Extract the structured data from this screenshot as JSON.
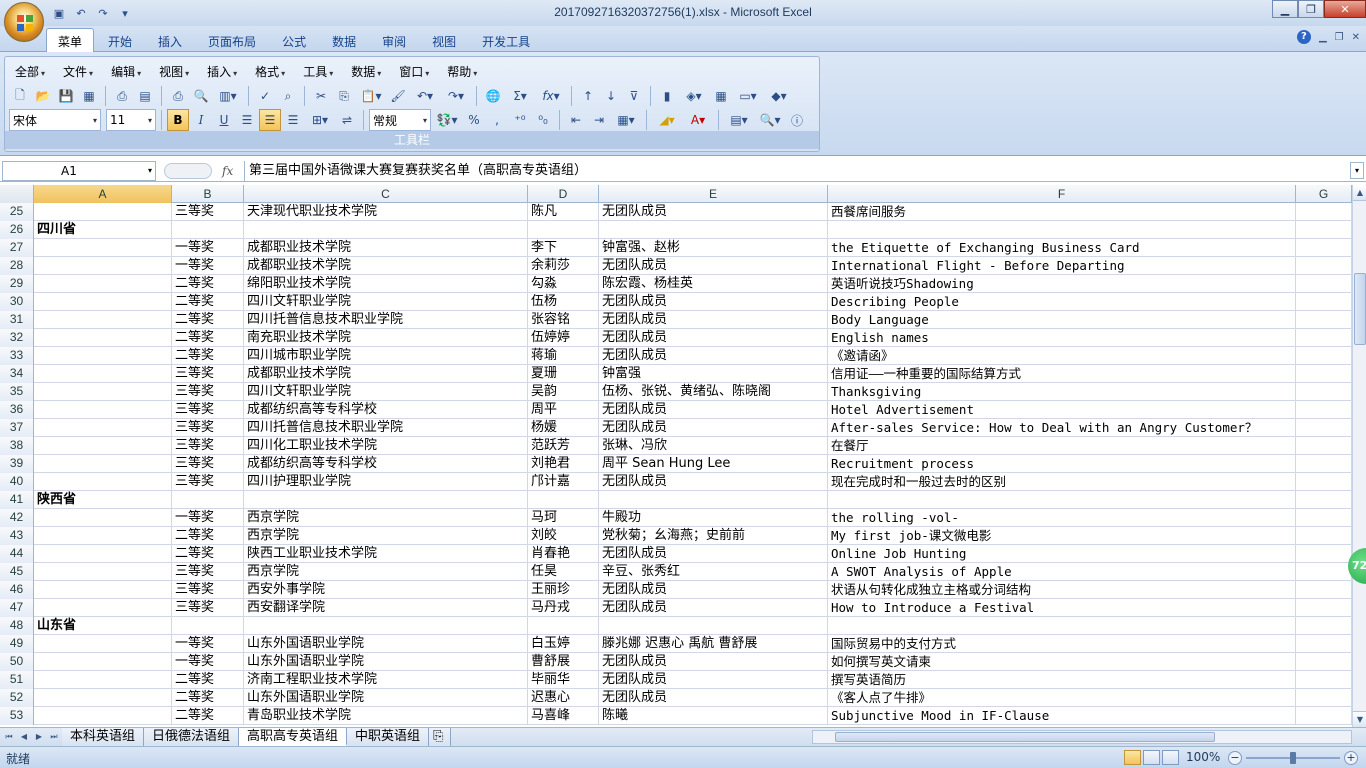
{
  "window": {
    "title": "2017092716320372756(1).xlsx - Microsoft Excel"
  },
  "ribbon_tabs": [
    "菜单",
    "开始",
    "插入",
    "页面布局",
    "公式",
    "数据",
    "审阅",
    "视图",
    "开发工具"
  ],
  "active_tab_index": 0,
  "menu_items": [
    "全部",
    "文件",
    "编辑",
    "视图",
    "插入",
    "格式",
    "工具",
    "数据",
    "窗口",
    "帮助"
  ],
  "toolbar": {
    "font_name": "宋体",
    "font_size": "11",
    "number_format": "常规",
    "bold_label": "B",
    "italic_label": "I",
    "underline_label": "U",
    "sigma_label": "Σ",
    "fx_label": "fx",
    "percent_label": "%",
    "comma_label": ",",
    "group_label": "工具栏"
  },
  "formula_bar": {
    "name_box": "A1",
    "fx_label": "fx",
    "content": "第三届中国外语微课大赛复赛获奖名单（高职高专英语组）"
  },
  "columns": [
    "A",
    "B",
    "C",
    "D",
    "E",
    "F",
    "G"
  ],
  "rows": [
    {
      "n": "25",
      "a": "",
      "b": "三等奖",
      "c": "天津现代职业技术学院",
      "d": "陈凡",
      "e": "无团队成员",
      "f": "西餐席间服务"
    },
    {
      "n": "26",
      "a": "四川省",
      "b": "",
      "c": "",
      "d": "",
      "e": "",
      "f": ""
    },
    {
      "n": "27",
      "a": "",
      "b": "一等奖",
      "c": "成都职业技术学院",
      "d": "李下",
      "e": "钟富强、赵彬",
      "f": "the Etiquette of Exchanging Business Card"
    },
    {
      "n": "28",
      "a": "",
      "b": "一等奖",
      "c": "成都职业技术学院",
      "d": "余莉莎",
      "e": "无团队成员",
      "f": "International Flight - Before Departing"
    },
    {
      "n": "29",
      "a": "",
      "b": "二等奖",
      "c": "绵阳职业技术学院",
      "d": "勾淼",
      "e": "陈宏霞、杨桂英",
      "f": " 英语听说技巧Shadowing"
    },
    {
      "n": "30",
      "a": "",
      "b": "二等奖",
      "c": "四川文轩职业学院",
      "d": "伍杨",
      "e": "无团队成员",
      "f": "Describing People"
    },
    {
      "n": "31",
      "a": "",
      "b": "二等奖",
      "c": "四川托普信息技术职业学院",
      "d": "张容铭",
      "e": "无团队成员",
      "f": "Body Language"
    },
    {
      "n": "32",
      "a": "",
      "b": "二等奖",
      "c": "南充职业技术学院",
      "d": "伍婷婷",
      "e": "无团队成员",
      "f": "English names"
    },
    {
      "n": "33",
      "a": "",
      "b": "二等奖",
      "c": "四川城市职业学院",
      "d": "蒋瑜",
      "e": "无团队成员",
      "f": "《邀请函》"
    },
    {
      "n": "34",
      "a": "",
      "b": "三等奖",
      "c": "成都职业技术学院",
      "d": "夏珊",
      "e": "钟富强",
      "f": "信用证——一种重要的国际结算方式"
    },
    {
      "n": "35",
      "a": "",
      "b": "三等奖",
      "c": "四川文轩职业学院",
      "d": "吴韵",
      "e": "伍杨、张锐、黄绪弘、陈晓阁",
      "f": "Thanksgiving"
    },
    {
      "n": "36",
      "a": "",
      "b": "三等奖",
      "c": "成都纺织高等专科学校",
      "d": "周平",
      "e": "无团队成员",
      "f": "Hotel Advertisement"
    },
    {
      "n": "37",
      "a": "",
      "b": "三等奖",
      "c": "四川托普信息技术职业学院",
      "d": "杨媛",
      "e": "无团队成员",
      "f": "After-sales Service:  How to Deal with an Angry Customer？"
    },
    {
      "n": "38",
      "a": "",
      "b": "三等奖",
      "c": "四川化工职业技术学院",
      "d": "范跃芳",
      "e": "张琳、冯欣",
      "f": "在餐厅"
    },
    {
      "n": "39",
      "a": "",
      "b": "三等奖",
      "c": "成都纺织高等专科学校",
      "d": "刘艳君",
      "e": "周平 Sean Hung Lee",
      "f": "Recruitment process"
    },
    {
      "n": "40",
      "a": "",
      "b": "三等奖",
      "c": "四川护理职业学院",
      "d": "邝计嘉",
      "e": "无团队成员",
      "f": "现在完成时和一般过去时的区别"
    },
    {
      "n": "41",
      "a": "陕西省",
      "b": "",
      "c": "",
      "d": "",
      "e": "",
      "f": ""
    },
    {
      "n": "42",
      "a": "",
      "b": "一等奖",
      "c": "西京学院",
      "d": "马珂",
      "e": "牛殿功",
      "f": "the rolling -vol-"
    },
    {
      "n": "43",
      "a": "",
      "b": "二等奖",
      "c": "西京学院",
      "d": "刘皎",
      "e": "党秋菊；幺海燕；史前前",
      "f": "My first job-课文微电影"
    },
    {
      "n": "44",
      "a": "",
      "b": "二等奖",
      "c": "陕西工业职业技术学院",
      "d": "肖春艳",
      "e": "无团队成员",
      "f": "Online Job Hunting"
    },
    {
      "n": "45",
      "a": "",
      "b": "三等奖",
      "c": "西京学院",
      "d": "任昊",
      "e": "辛豆、张秀红",
      "f": "A SWOT Analysis of Apple"
    },
    {
      "n": "46",
      "a": "",
      "b": "三等奖",
      "c": "西安外事学院",
      "d": "王丽珍",
      "e": "无团队成员",
      "f": "状语从句转化成独立主格或分词结构"
    },
    {
      "n": "47",
      "a": "",
      "b": "三等奖",
      "c": "西安翻译学院",
      "d": "马丹戎",
      "e": "无团队成员",
      "f": "How to Introduce a Festival"
    },
    {
      "n": "48",
      "a": "山东省",
      "b": "",
      "c": "",
      "d": "",
      "e": "",
      "f": ""
    },
    {
      "n": "49",
      "a": "",
      "b": "一等奖",
      "c": "山东外国语职业学院",
      "d": "白玉婷",
      "e": "滕兆娜 迟惠心 禹航 曹舒展",
      "f": "国际贸易中的支付方式"
    },
    {
      "n": "50",
      "a": "",
      "b": "一等奖",
      "c": "山东外国语职业学院",
      "d": "曹舒展",
      "e": "无团队成员",
      "f": "如何撰写英文请柬"
    },
    {
      "n": "51",
      "a": "",
      "b": "二等奖",
      "c": "济南工程职业技术学院",
      "d": "毕丽华",
      "e": "无团队成员",
      "f": "撰写英语简历"
    },
    {
      "n": "52",
      "a": "",
      "b": "二等奖",
      "c": "山东外国语职业学院",
      "d": "迟惠心",
      "e": "无团队成员",
      "f": "《客人点了牛排》"
    },
    {
      "n": "53",
      "a": "",
      "b": "二等奖",
      "c": "青岛职业技术学院",
      "d": "马喜峰",
      "e": "陈曦",
      "f": "Subjunctive Mood in IF-Clause"
    }
  ],
  "sheet_tabs": [
    "本科英语组",
    "日俄德法语组",
    "高职高专英语组",
    "中职英语组"
  ],
  "active_sheet_index": 2,
  "status": {
    "ready": "就绪",
    "zoom": "100%"
  },
  "float_badge": "72"
}
